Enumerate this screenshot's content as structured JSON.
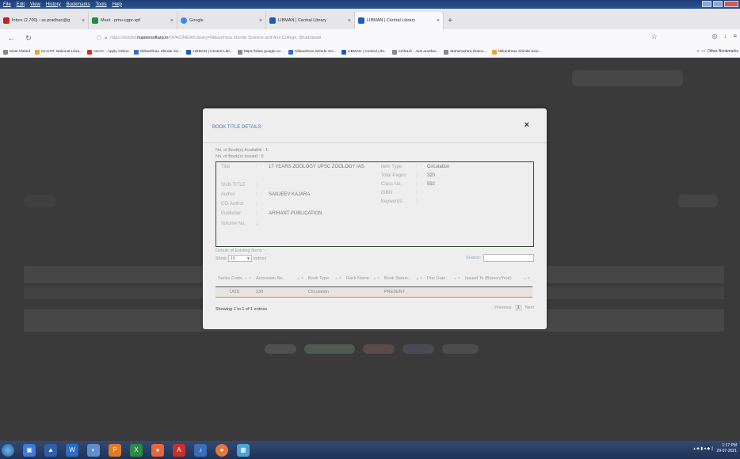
{
  "menubar": {
    "items": [
      "File",
      "Edit",
      "View",
      "History",
      "Bookmarks",
      "Tools",
      "Help"
    ]
  },
  "tabs": [
    {
      "title": "Inbox (2,700) - ss.pradhan@g",
      "color": "#c5221f"
    },
    {
      "title": "Meet - pmu-ugpr-vpf",
      "color": "#1e8e3e"
    },
    {
      "title": "Google",
      "color": "#4285f4"
    },
    {
      "title": "LIBMAN | Central Library",
      "color": "#1a5fb4"
    },
    {
      "title": "LIBMAN | Central Library",
      "color": "#1a5fb4"
    }
  ],
  "url": {
    "prefix": "https://lsdcbd.",
    "domain": "mastersoftarp.in",
    "path": "/OPAC/NEW/Library=Nilkanthrao Shinde Science and Arts College, Bhadrawati"
  },
  "bookmarks": [
    {
      "label": "Most Visited",
      "color": "#888"
    },
    {
      "label": "IN-LIST: National Libra...",
      "color": "#e8a33a"
    },
    {
      "label": "NAAC - Apply Online",
      "color": "#d93025"
    },
    {
      "label": "Nilkanthrao Shinde Sci...",
      "color": "#3b6fc4"
    },
    {
      "label": "LIBMAN | Central Libr...",
      "color": "#1a5fb4"
    },
    {
      "label": "https://sites.google.co...",
      "color": "#888"
    },
    {
      "label": "Nilkanthrao Shinde Sci...",
      "color": "#3b6fc4"
    },
    {
      "label": "LIBMAN | Central Libr...",
      "color": "#1a5fb4"
    },
    {
      "label": "eInfoLib - Just another...",
      "color": "#888"
    },
    {
      "label": "Maharashtra Notion...",
      "color": "#888"
    },
    {
      "label": "Nilkanthrao Shinde Scie...",
      "color": "#e8a33a"
    }
  ],
  "other_bookmarks": "Other Bookmarks",
  "modal": {
    "title": "BOOK TITLE DETAILS",
    "available": "No. of Book(s) Available : 1",
    "issued": "No. of Book(s) Issued : 0",
    "left_fields": [
      {
        "label": "Title",
        "value": "17 YEARS ZOOLOGY UPSC ZOOLOGY IAS"
      },
      {
        "label": "SUB-TITLE",
        "value": ""
      },
      {
        "label": "Author",
        "value": "SANJEEV KAJARA"
      },
      {
        "label": "CO-Author",
        "value": ""
      },
      {
        "label": "Publisher",
        "value": "ARIHANT PUBLICATION"
      },
      {
        "label": "Volume No.",
        "value": ""
      }
    ],
    "right_fields": [
      {
        "label": "Item Type",
        "value": "Circulation"
      },
      {
        "label": "Total Pages",
        "value": "320"
      },
      {
        "label": "Class No.",
        "value": "592"
      },
      {
        "label": "ISBN",
        "value": ""
      },
      {
        "label": "Keywords",
        "value": ""
      }
    ],
    "existing_label": "Details of Existing Items :-",
    "show_label": "Show",
    "show_value": "10",
    "entries_label": "entries",
    "search_label": "Search:",
    "columns": [
      "Series Code.",
      "Accession No.",
      "Book Type.",
      "Rack Name.",
      "Book Status.",
      "Due Date.",
      "Issued To (Branch/Year)"
    ],
    "rows": [
      [
        "UOS",
        "230",
        "Circulation",
        "",
        "PRESENT",
        "",
        ""
      ]
    ],
    "showing": "Showing 1 to 1 of 1 entries",
    "prev": "Previous",
    "page": "1",
    "next": "Next"
  },
  "tray": {
    "time": "1:17 PM",
    "date": "29-07-2021"
  }
}
